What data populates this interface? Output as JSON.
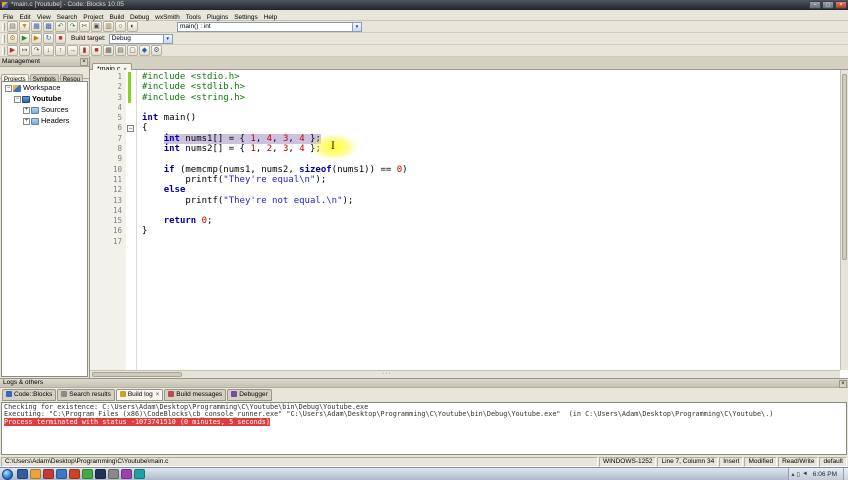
{
  "window": {
    "title": "*main.c [Youtube] - Code::Blocks 10.05"
  },
  "glyphs": {
    "dropdown": "▼",
    "close": "×",
    "minimize": "–",
    "maximize": "▢",
    "grip_dots": "···"
  },
  "menubar": [
    "File",
    "Edit",
    "View",
    "Search",
    "Project",
    "Build",
    "Debug",
    "wxSmith",
    "Tools",
    "Plugins",
    "Settings",
    "Help"
  ],
  "toolbar": {
    "symbol_combo_value": "main() : int",
    "build_target_label": "Build target:",
    "build_target_value": "Debug",
    "row1_icons": [
      {
        "name": "new-file-icon",
        "glyph": "▤",
        "color": "#6a6a5a"
      },
      {
        "name": "open-file-icon",
        "glyph": "▼",
        "color": "#c89020"
      },
      {
        "name": "save-icon",
        "glyph": "▦",
        "color": "#3a5fa8"
      },
      {
        "name": "save-all-icon",
        "glyph": "▩",
        "color": "#3a5fa8"
      },
      {
        "name": "undo-icon",
        "glyph": "↶",
        "color": "#2a7a2a"
      },
      {
        "name": "redo-icon",
        "glyph": "↷",
        "color": "#2a7a2a"
      },
      {
        "name": "cut-icon",
        "glyph": "✂",
        "color": "#555555"
      },
      {
        "name": "copy-icon",
        "glyph": "▣",
        "color": "#555555"
      },
      {
        "name": "paste-icon",
        "glyph": "▥",
        "color": "#8a6a3a"
      },
      {
        "name": "find-icon",
        "glyph": "○",
        "color": "#333333"
      },
      {
        "name": "replace-icon",
        "glyph": "◐",
        "color": "#333333"
      }
    ],
    "row2_icons": [
      {
        "name": "build-icon",
        "glyph": "⚙",
        "color": "#b8860b"
      },
      {
        "name": "run-icon",
        "glyph": "▶",
        "color": "#2a8a2a"
      },
      {
        "name": "build-and-run-icon",
        "glyph": "▶",
        "color": "#b8860b"
      },
      {
        "name": "rebuild-icon",
        "glyph": "↻",
        "color": "#2a5faa"
      },
      {
        "name": "abort-build-icon",
        "glyph": "■",
        "color": "#c03030"
      }
    ],
    "row3_icons": [
      {
        "name": "debug-continue-icon",
        "glyph": "▶",
        "color": "#b03030"
      },
      {
        "name": "run-to-cursor-icon",
        "glyph": "↦",
        "color": "#555555"
      },
      {
        "name": "next-line-icon",
        "glyph": "↷",
        "color": "#555555"
      },
      {
        "name": "step-into-icon",
        "glyph": "↓",
        "color": "#555555"
      },
      {
        "name": "step-out-icon",
        "glyph": "↑",
        "color": "#555555"
      },
      {
        "name": "next-instruction-icon",
        "glyph": "→",
        "color": "#555555"
      },
      {
        "name": "break-debugger-icon",
        "glyph": "▮",
        "color": "#b03030"
      },
      {
        "name": "stop-debugger-icon",
        "glyph": "■",
        "color": "#b03030"
      },
      {
        "name": "debugging-windows-icon",
        "glyph": "▦",
        "color": "#555555"
      },
      {
        "name": "various-info-icon",
        "glyph": "▤",
        "color": "#555555"
      },
      {
        "name": "new-file-small-icon",
        "glyph": "▢",
        "color": "#555555"
      },
      {
        "name": "wxsmith-icon",
        "glyph": "◆",
        "color": "#2a5faa"
      },
      {
        "name": "settings-small-icon",
        "glyph": "⚙",
        "color": "#555555"
      }
    ]
  },
  "management": {
    "title": "Management",
    "tabs": [
      {
        "label": "Projects",
        "active": true
      },
      {
        "label": "Symbols",
        "active": false
      },
      {
        "label": "Resou",
        "active": false
      }
    ],
    "tree": [
      {
        "label": "Workspace",
        "depth": 0,
        "icon": "workspace",
        "bold": false,
        "expander": "minus"
      },
      {
        "label": "Youtube",
        "depth": 1,
        "icon": "project",
        "bold": true,
        "expander": "minus"
      },
      {
        "label": "Sources",
        "depth": 2,
        "icon": "folder",
        "bold": false,
        "expander": "plus"
      },
      {
        "label": "Headers",
        "depth": 2,
        "icon": "folder",
        "bold": false,
        "expander": "plus"
      }
    ]
  },
  "editor": {
    "tab": "*main.c",
    "lines": [
      {
        "n": 1,
        "changed": true,
        "tokens": [
          [
            "pp",
            "#include <stdio.h>"
          ]
        ]
      },
      {
        "n": 2,
        "changed": true,
        "tokens": [
          [
            "pp",
            "#include <stdlib.h>"
          ]
        ]
      },
      {
        "n": 3,
        "changed": true,
        "tokens": [
          [
            "pp",
            "#include <string.h>"
          ]
        ]
      },
      {
        "n": 4,
        "tokens": []
      },
      {
        "n": 5,
        "tokens": [
          [
            "kw",
            "int"
          ],
          [
            "pl",
            " main()"
          ]
        ]
      },
      {
        "n": 6,
        "fold": true,
        "tokens": [
          [
            "pl",
            "{"
          ]
        ]
      },
      {
        "n": 7,
        "sel_from": 1,
        "tokens": [
          [
            "pl",
            "    "
          ],
          [
            "kw",
            "int"
          ],
          [
            "pl",
            " nums1[] = { "
          ],
          [
            "num",
            "1"
          ],
          [
            "pl",
            ", "
          ],
          [
            "num",
            "4"
          ],
          [
            "pl",
            ", "
          ],
          [
            "num",
            "3"
          ],
          [
            "pl",
            ", "
          ],
          [
            "num",
            "4"
          ],
          [
            "pl",
            " };"
          ]
        ]
      },
      {
        "n": 8,
        "tokens": [
          [
            "pl",
            "    "
          ],
          [
            "kw",
            "int"
          ],
          [
            "pl",
            " nums2[] = { "
          ],
          [
            "num",
            "1"
          ],
          [
            "pl",
            ", "
          ],
          [
            "num",
            "2"
          ],
          [
            "pl",
            ", "
          ],
          [
            "num",
            "3"
          ],
          [
            "pl",
            ", "
          ],
          [
            "num",
            "4"
          ],
          [
            "pl",
            " };"
          ]
        ]
      },
      {
        "n": 9,
        "tokens": []
      },
      {
        "n": 10,
        "tokens": [
          [
            "pl",
            "    "
          ],
          [
            "kw",
            "if"
          ],
          [
            "pl",
            " (memcmp(nums1, nums2, "
          ],
          [
            "kw",
            "sizeof"
          ],
          [
            "pl",
            "(nums1)) == "
          ],
          [
            "num",
            "0"
          ],
          [
            "pl",
            ")"
          ]
        ]
      },
      {
        "n": 11,
        "tokens": [
          [
            "pl",
            "        printf("
          ],
          [
            "str",
            "\"They're equal\\n\""
          ],
          [
            "pl",
            ");"
          ]
        ]
      },
      {
        "n": 12,
        "tokens": [
          [
            "pl",
            "    "
          ],
          [
            "kw",
            "else"
          ]
        ]
      },
      {
        "n": 13,
        "tokens": [
          [
            "pl",
            "        printf("
          ],
          [
            "str",
            "\"They're not equal.\\n\""
          ],
          [
            "pl",
            ");"
          ]
        ]
      },
      {
        "n": 14,
        "tokens": []
      },
      {
        "n": 15,
        "tokens": [
          [
            "pl",
            "    "
          ],
          [
            "kw",
            "return"
          ],
          [
            "pl",
            " "
          ],
          [
            "num",
            "0"
          ],
          [
            "pl",
            ";"
          ]
        ]
      },
      {
        "n": 16,
        "tokens": [
          [
            "pl",
            "}"
          ]
        ]
      },
      {
        "n": 17,
        "tokens": []
      }
    ]
  },
  "logs": {
    "title": "Logs & others",
    "tabs": [
      {
        "label": "Code::Blocks",
        "icon": "codeblocks-log-icon",
        "icon_color": "#3a66c8",
        "active": false,
        "closable": false
      },
      {
        "label": "Search results",
        "icon": "search-results-icon",
        "icon_color": "#8a8a8a",
        "active": false,
        "closable": false
      },
      {
        "label": "Build log",
        "icon": "build-log-icon",
        "icon_color": "#c8a02a",
        "active": true,
        "closable": true
      },
      {
        "label": "Build messages",
        "icon": "build-messages-icon",
        "icon_color": "#b05050",
        "active": false,
        "closable": false
      },
      {
        "label": "Debugger",
        "icon": "debugger-log-icon",
        "icon_color": "#7a4aa0",
        "active": false,
        "closable": false
      }
    ],
    "lines": [
      {
        "type": "normal",
        "text": "Checking for existence: C:\\Users\\Adam\\Desktop\\Programming\\C\\Youtube\\bin\\Debug\\Youtube.exe"
      },
      {
        "type": "normal",
        "text": "Executing: \"C:\\Program Files (x86)\\CodeBlocks\\cb_console_runner.exe\" \"C:\\Users\\Adam\\Desktop\\Programming\\C\\Youtube\\bin\\Debug\\Youtube.exe\"  (in C:\\Users\\Adam\\Desktop\\Programming\\C\\Youtube\\.)"
      },
      {
        "type": "error",
        "text": "Process terminated with status -1073741510 (0 minutes, 5 seconds)"
      }
    ]
  },
  "statusbar": [
    {
      "name": "status-file-path",
      "text": "C:\\Users\\Adam\\Desktop\\Programming\\C\\Youtube\\main.c",
      "grow": true
    },
    {
      "name": "status-encoding",
      "text": "WINDOWS-1252",
      "grow": false
    },
    {
      "name": "status-caret-position",
      "text": "Line 7, Column 34",
      "grow": false
    },
    {
      "name": "status-insert-mode",
      "text": "Insert",
      "grow": false
    },
    {
      "name": "status-modified",
      "text": "Modified",
      "grow": false
    },
    {
      "name": "status-readwrite",
      "text": "Read/Write",
      "grow": false
    },
    {
      "name": "status-profile",
      "text": "default",
      "grow": false
    }
  ],
  "taskbar": {
    "time": "6:06 PM",
    "apps": [
      {
        "name": "taskbar-app-icon",
        "color": "#355a9e"
      },
      {
        "name": "taskbar-app-icon",
        "color": "#e8a33d"
      },
      {
        "name": "taskbar-app-icon",
        "color": "#c23b3b"
      },
      {
        "name": "taskbar-app-icon",
        "color": "#3b77c2"
      },
      {
        "name": "taskbar-app-icon",
        "color": "#cc4422"
      },
      {
        "name": "taskbar-app-icon",
        "color": "#44aa44"
      },
      {
        "name": "taskbar-app-icon",
        "color": "#223355"
      },
      {
        "name": "taskbar-app-icon",
        "color": "#888888"
      },
      {
        "name": "taskbar-app-icon",
        "color": "#9944aa"
      },
      {
        "name": "taskbar-app-icon",
        "color": "#20a0a0"
      }
    ],
    "tray_icons": [
      {
        "name": "tray-expand-icon",
        "glyph": "▴"
      },
      {
        "name": "tray-network-icon",
        "glyph": "▯"
      },
      {
        "name": "tray-volume-icon",
        "glyph": "◄"
      }
    ]
  }
}
